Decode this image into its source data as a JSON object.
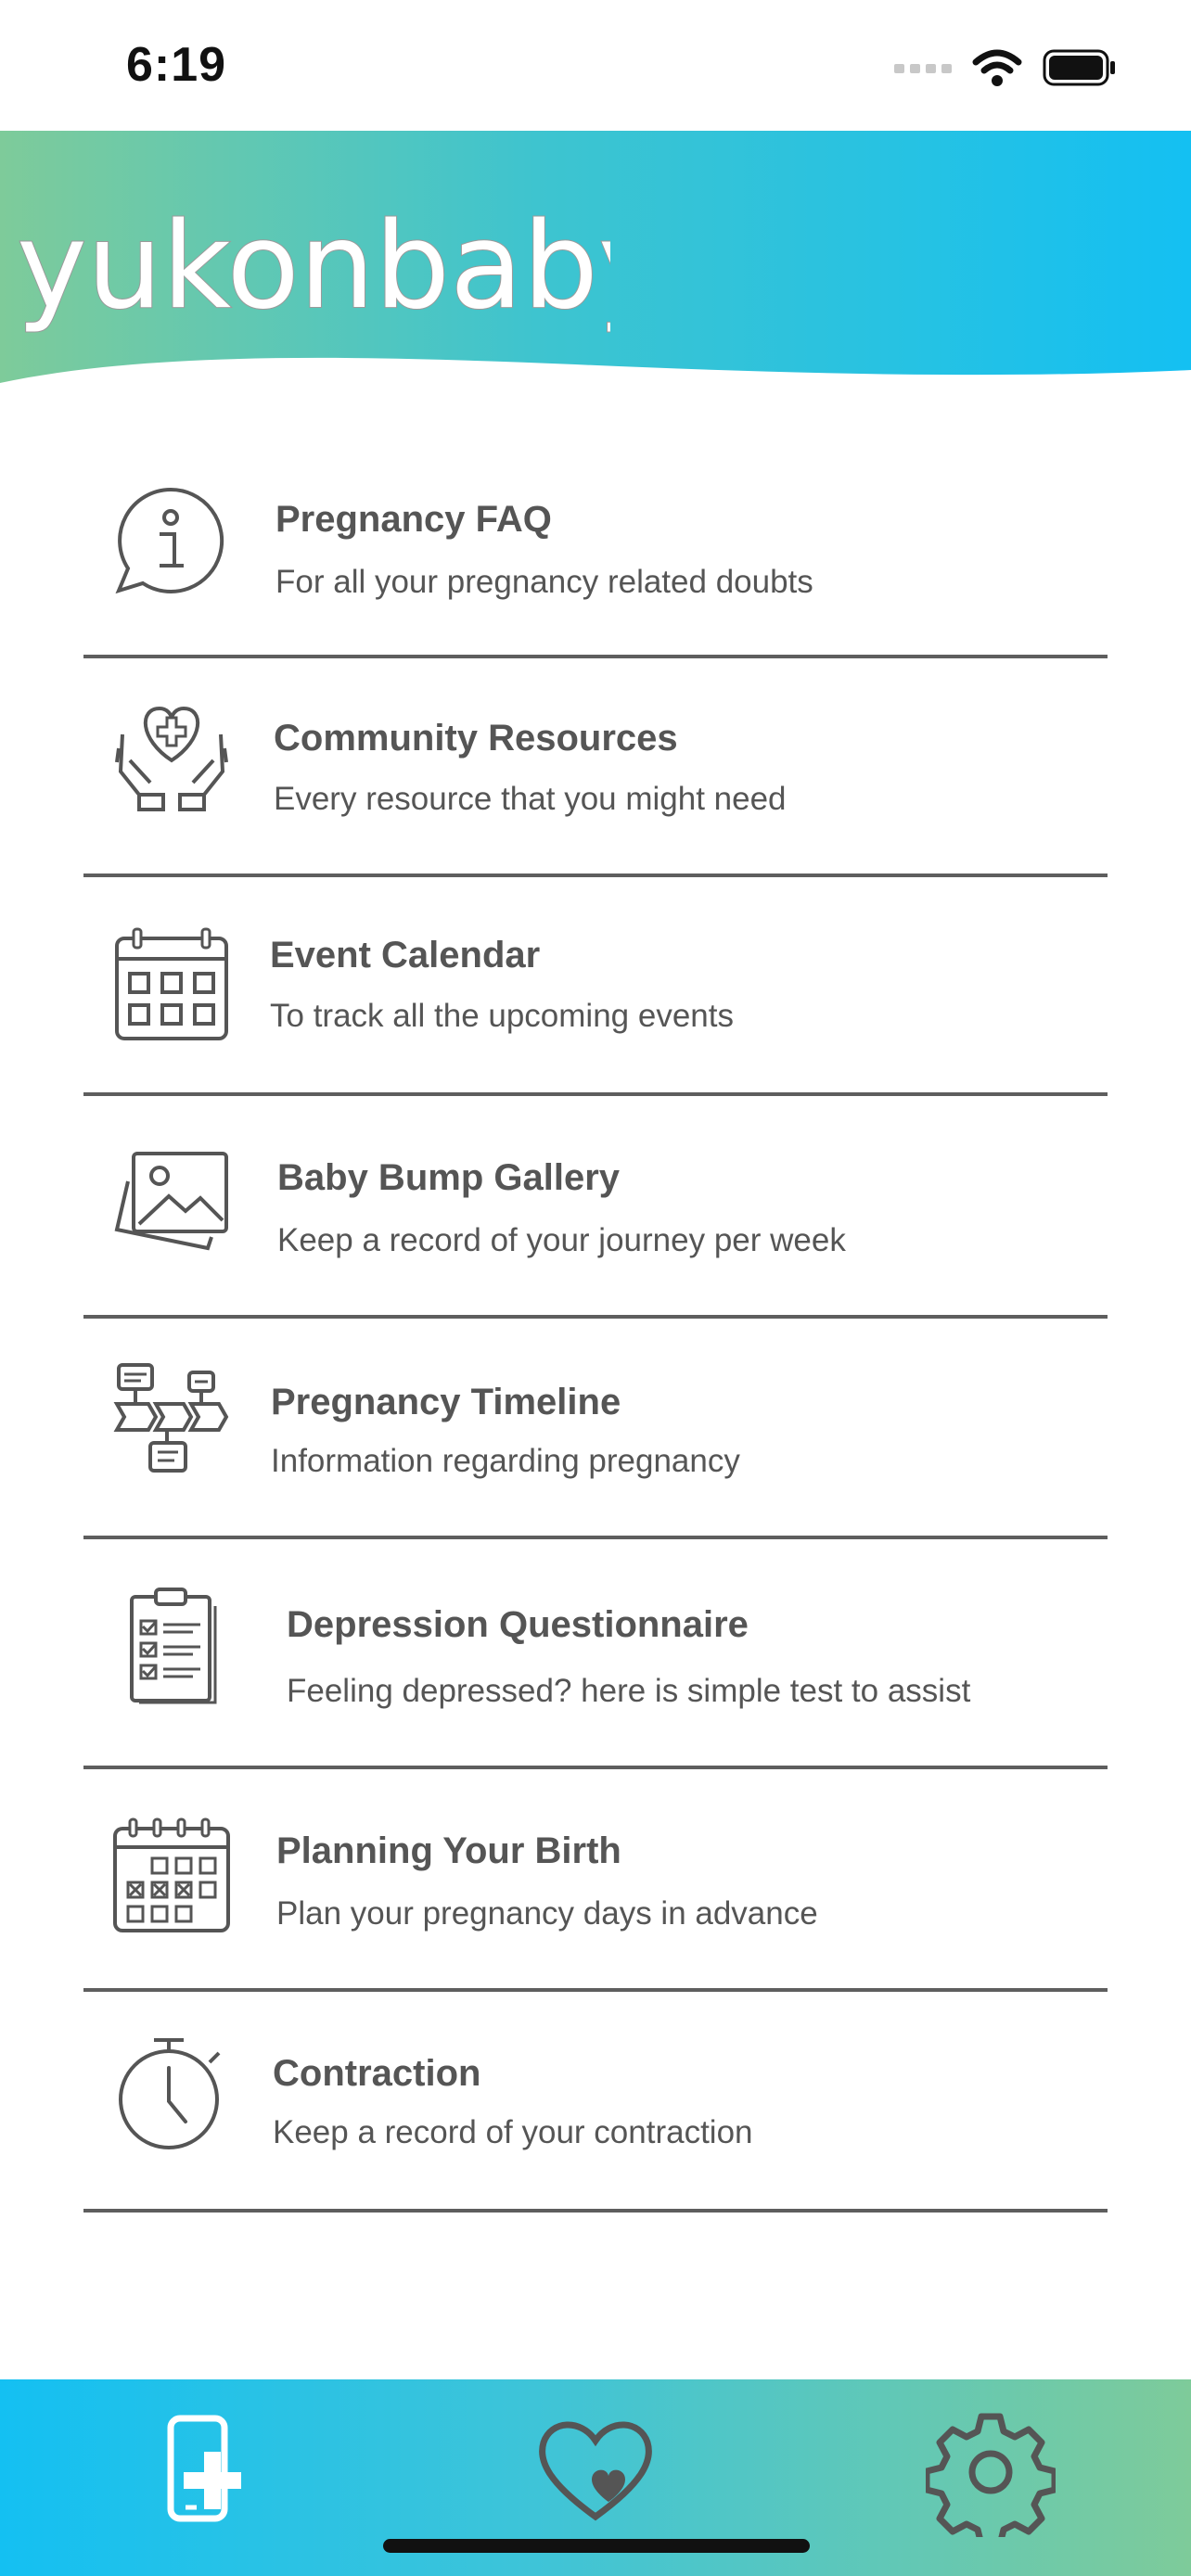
{
  "status_bar": {
    "time": "6:19",
    "icons": [
      "signal-icon",
      "wifi-icon",
      "battery-icon"
    ]
  },
  "header": {
    "logo_text": "yukonbaby",
    "gradient": [
      "#7ecb9a",
      "#14c0f2"
    ]
  },
  "menu": {
    "items": [
      {
        "title": "Pregnancy FAQ",
        "subtitle": "For all your pregnancy related doubts",
        "icon": "info-chat-icon"
      },
      {
        "title": "Community Resources",
        "subtitle": "Every resource that you might need",
        "icon": "hands-heart-icon"
      },
      {
        "title": "Event Calendar",
        "subtitle": "To track all the upcoming events",
        "icon": "calendar-icon"
      },
      {
        "title": "Baby Bump Gallery",
        "subtitle": "Keep a record of your journey per week",
        "icon": "gallery-icon"
      },
      {
        "title": "Pregnancy Timeline",
        "subtitle": "Information regarding pregnancy",
        "icon": "timeline-icon"
      },
      {
        "title": "Depression Questionnaire",
        "subtitle": "Feeling depressed? here is simple test to assist",
        "icon": "checklist-icon"
      },
      {
        "title": "Planning Your Birth",
        "subtitle": "Plan your pregnancy days in advance",
        "icon": "planner-icon"
      },
      {
        "title": "Contraction",
        "subtitle": "Keep a record of your contraction",
        "icon": "stopwatch-icon"
      }
    ]
  },
  "tab_bar": {
    "tabs": [
      {
        "name": "mobile-health-icon",
        "active": true
      },
      {
        "name": "heart-icon",
        "active": false
      },
      {
        "name": "settings-icon",
        "active": false
      }
    ]
  }
}
